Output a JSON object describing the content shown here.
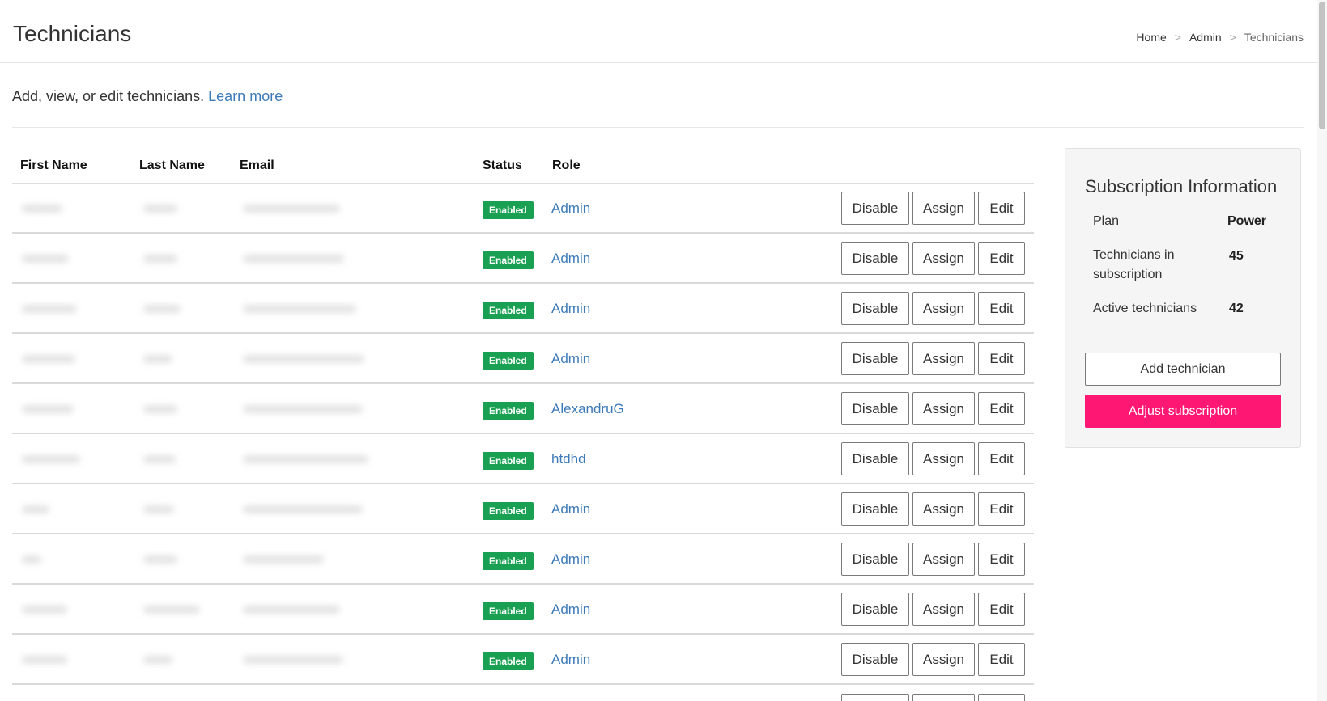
{
  "header": {
    "title": "Technicians",
    "breadcrumb": [
      {
        "label": "Home"
      },
      {
        "label": "Admin"
      },
      {
        "label": "Technicians"
      }
    ],
    "separator": ">"
  },
  "intro": {
    "text": "Add, view, or edit technicians.",
    "learn_more": "Learn more"
  },
  "table": {
    "columns": {
      "first_name": "First Name",
      "last_name": "Last Name",
      "email": "Email",
      "status": "Status",
      "role": "Role"
    },
    "rows": [
      {
        "status": "Enabled",
        "role": "Admin"
      },
      {
        "status": "Enabled",
        "role": "Admin"
      },
      {
        "status": "Enabled",
        "role": "Admin"
      },
      {
        "status": "Enabled",
        "role": "Admin"
      },
      {
        "status": "Enabled",
        "role": "AlexandruG"
      },
      {
        "status": "Enabled",
        "role": "htdhd"
      },
      {
        "status": "Enabled",
        "role": "Admin"
      },
      {
        "status": "Enabled",
        "role": "Admin"
      },
      {
        "status": "Enabled",
        "role": "Admin"
      },
      {
        "status": "Enabled",
        "role": "Admin"
      }
    ],
    "actions": {
      "disable": "Disable",
      "assign": "Assign",
      "edit": "Edit"
    },
    "status_color": "#1aa052"
  },
  "subscription": {
    "title": "Subscription Information",
    "plan_label": "Plan",
    "plan_value": "Power",
    "technicians_label": "Technicians in subscription",
    "technicians_value": "45",
    "active_label": "Active technicians",
    "active_value": "42",
    "add_button": "Add technician",
    "adjust_button": "Adjust subscription",
    "accent_color": "#ff1873"
  }
}
